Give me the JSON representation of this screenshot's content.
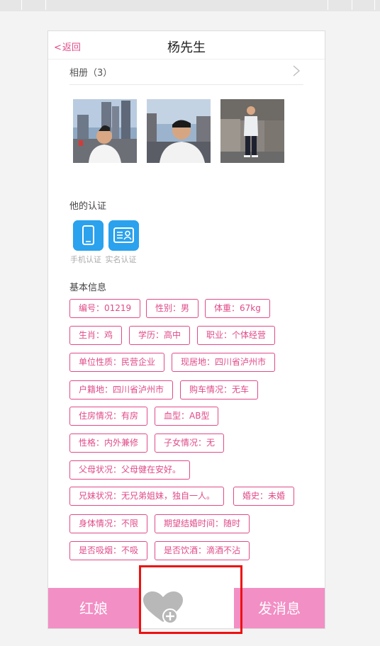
{
  "header": {
    "back_label": "返回",
    "title": "杨先生"
  },
  "album": {
    "label": "相册（3）"
  },
  "certification": {
    "title": "他的认证",
    "items": [
      "手机认证",
      "实名认证"
    ]
  },
  "basic_info": {
    "title": "基本信息",
    "tags": [
      "编号：01219",
      "性别：男",
      "体重：67kg",
      "生肖：鸡",
      "学历：高中",
      "职业：个体经营",
      "单位性质：民营企业",
      "现居地：四川省泸州市",
      "户籍地：四川省泸州市",
      "购车情况：无车",
      "住房情况：有房",
      "血型：AB型",
      "性格：内外兼修",
      "子女情况：无",
      "父母状况：父母健在安好。",
      "兄妹状况：无兄弟姐妹，独自一人。",
      "婚史：未婚",
      "身体情况：不限",
      "期望结婚时间：随时",
      "是否吸烟：不吸",
      "是否饮酒：滴酒不沾"
    ]
  },
  "footer": {
    "left_label": "红娘",
    "right_label": "发消息"
  },
  "colors": {
    "accent": "#e04a88",
    "footer_pink": "#f28fc5",
    "highlight": "#ee1111"
  }
}
